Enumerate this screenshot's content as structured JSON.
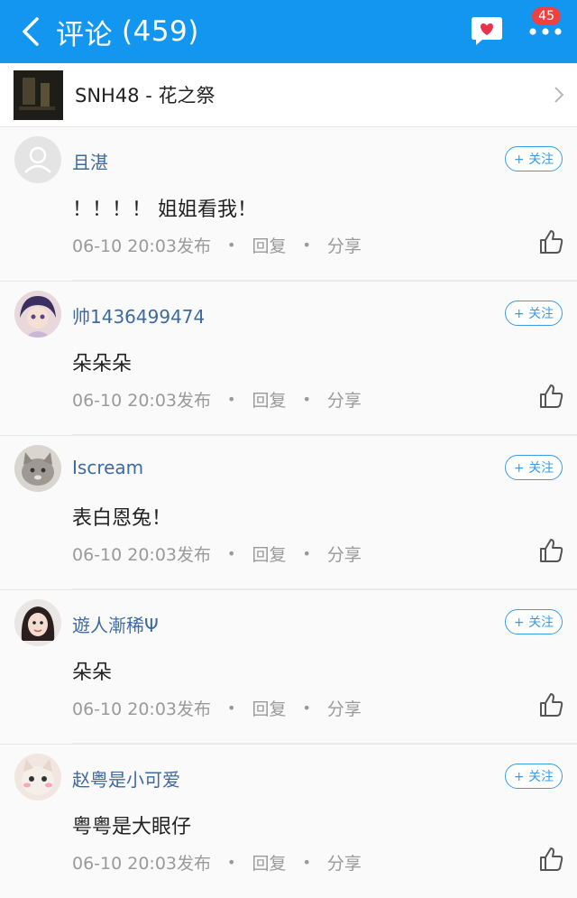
{
  "header": {
    "title": "评论",
    "count": "(459)",
    "badge": "45",
    "back_icon": "chevron-left-icon",
    "message_icon": "heart-message-icon",
    "more_icon": "more-dots-icon",
    "bg_color": "#1296f0"
  },
  "song": {
    "title": "SNH48 - 花之祭"
  },
  "comments": [
    {
      "user": "且湛",
      "follow": "+ 关注",
      "text": "！！！！ 姐姐看我！",
      "time": "06-10 20:03发布",
      "reply": "回复",
      "share": "分享",
      "avatar": "default"
    },
    {
      "user": "帅1436499474",
      "follow": "+ 关注",
      "text": "朵朵朵",
      "time": "06-10 20:03发布",
      "reply": "回复",
      "share": "分享",
      "avatar": "anime"
    },
    {
      "user": "Iscream",
      "follow": "+ 关注",
      "text": "表白恩兔！",
      "time": "06-10 20:03发布",
      "reply": "回复",
      "share": "分享",
      "avatar": "cat"
    },
    {
      "user": "遊人漸稀Ψ",
      "follow": "+ 关注",
      "text": "朵朵",
      "time": "06-10 20:03发布",
      "reply": "回复",
      "share": "分享",
      "avatar": "girl"
    },
    {
      "user": "赵粤是小可爱",
      "follow": "+ 关注",
      "text": "粤粤是大眼仔",
      "time": "06-10 20:03发布",
      "reply": "回复",
      "share": "分享",
      "avatar": "kitten"
    }
  ]
}
